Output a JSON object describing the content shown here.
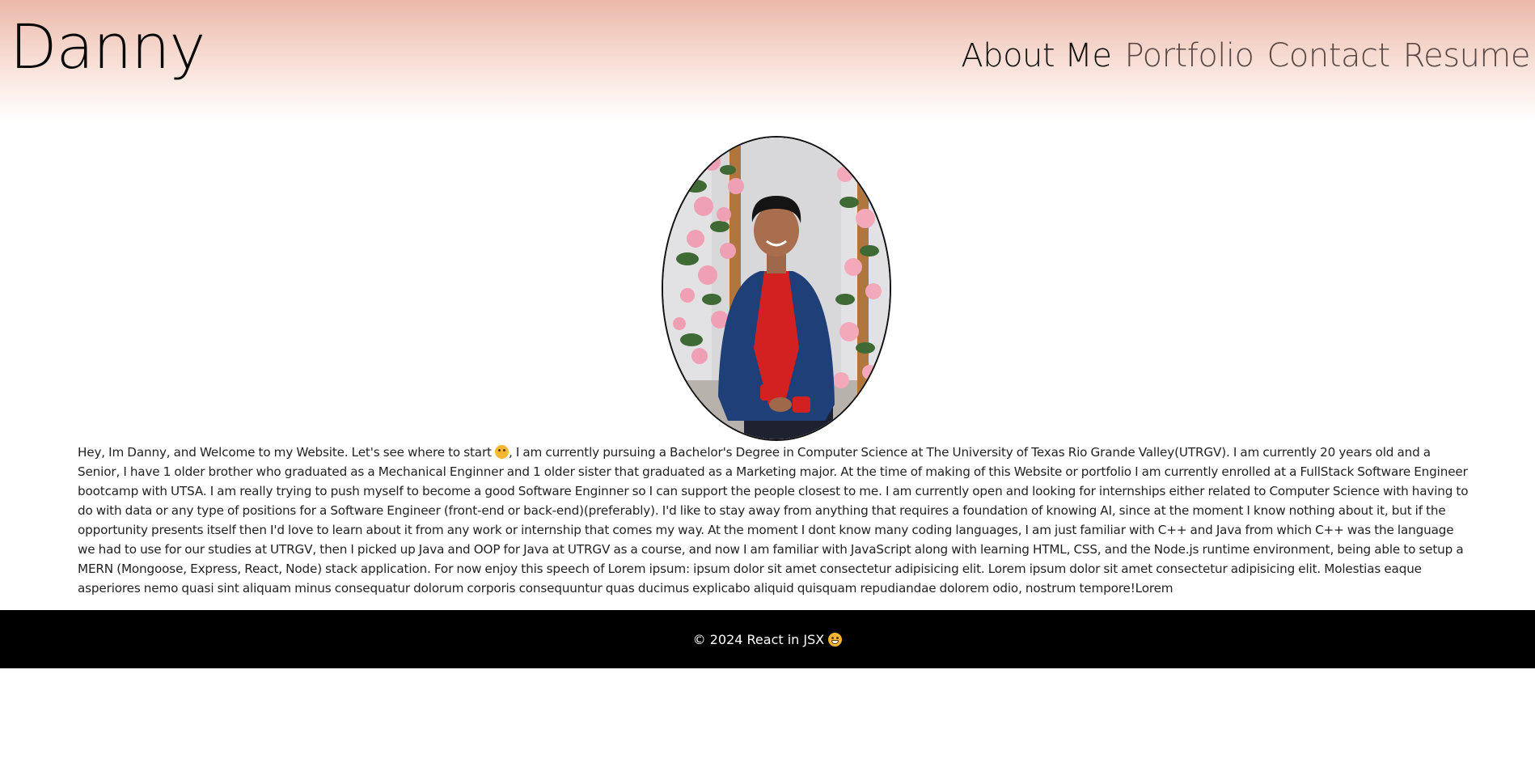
{
  "header": {
    "brand": "Danny",
    "nav": [
      {
        "label": "About Me",
        "active": true
      },
      {
        "label": "Portfolio",
        "active": false
      },
      {
        "label": "Contact",
        "active": false
      },
      {
        "label": "Resume",
        "active": false
      }
    ]
  },
  "colors": {
    "header_gradient_top": "#ebb8a9",
    "nav_inactive": "#5a4844",
    "footer_bg": "#000000",
    "footer_text": "#ffffff"
  },
  "profile": {
    "photo_icon": "profile-photo"
  },
  "bio": {
    "part1": "Hey, Im Danny, and Welcome to my Website. Let's see where to start ",
    "emoji1": "thinking-face",
    "part2": ", I am currently pursuing a Bachelor's Degree in Computer Science at The University of Texas Rio Grande Valley(UTRGV). I am currently 20 years old and a Senior, I have 1 older brother who graduated as a Mechanical Enginner and 1 older sister that graduated as a Marketing major. At the time of making of this Website or portfolio I am currently enrolled at a FullStack Software Engineer bootcamp with UTSA. I am really trying to push myself to become a good Software Enginner so I can support the people closest to me. I am currently open and looking for internships either related to Computer Science with having to do with data or any type of positions for a Software Engineer (front-end or back-end)(preferably). I'd like to stay away from anything that requires a foundation of knowing AI, since at the moment I know nothing about it, but if the opportunity presents itself then I'd love to learn about it from any work or internship that comes my way. At the moment I dont know many coding languages, I am just familiar with C++ and Java from which C++ was the language we had to use for our studies at UTRGV, then I picked up Java and OOP for Java at UTRGV as a course, and now I am familiar with JavaScript along with learning HTML, CSS, and the Node.js runtime environment, being able to setup a MERN (Mongoose, Express, React, Node) stack application. For now enjoy this speech of Lorem ipsum: ipsum dolor sit amet consectetur adipisicing elit. Lorem ipsum dolor sit amet consectetur adipisicing elit. Molestias eaque asperiores nemo quasi sint aliquam minus consequatur dolorum corporis consequuntur quas ducimus explicabo aliquid quisquam repudiandae dolorem odio, nostrum tempore!Lorem"
  },
  "footer": {
    "text": "© 2024 React in JSX ",
    "emoji": "grinning-face"
  }
}
